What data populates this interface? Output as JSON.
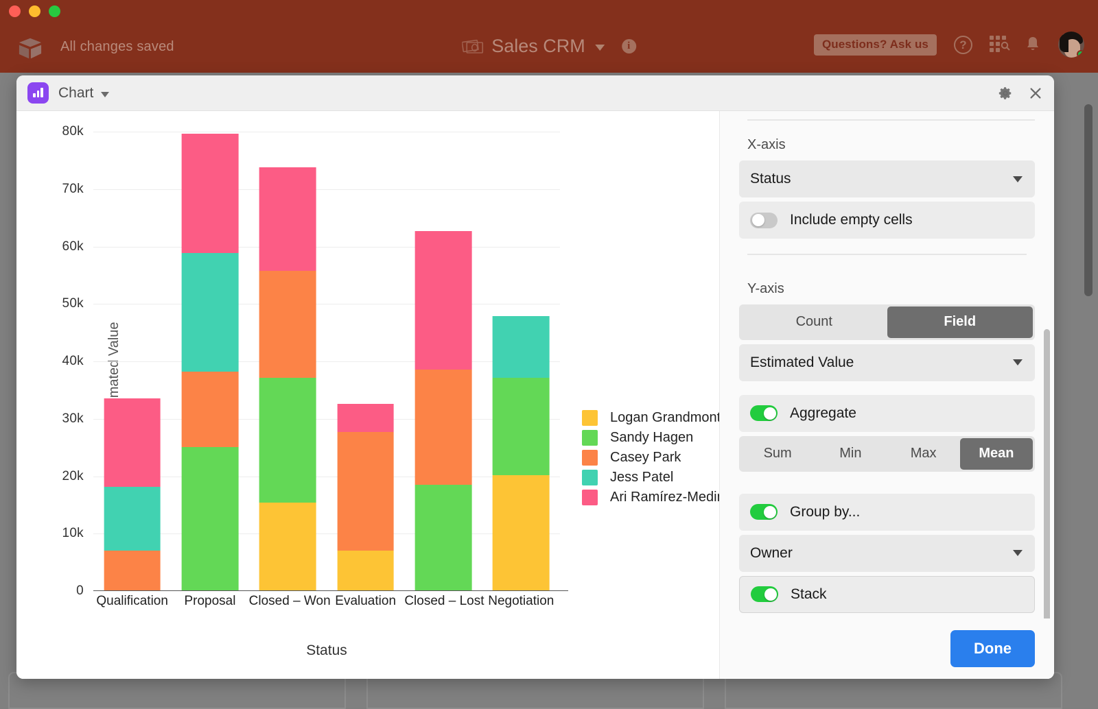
{
  "appbar": {
    "saved_status": "All changes saved",
    "base_name": "Sales CRM",
    "ask_label": "Questions? Ask us",
    "logo_icon": "airtable-cube-icon",
    "base_icon": "money-bills-icon",
    "info_icon": "info-icon",
    "help_icon": "question-mark-icon",
    "grid_icon": "apps-grid-search-icon",
    "bell_icon": "notification-bell-icon",
    "avatar_icon": "user-avatar",
    "bg_color": "#84301c"
  },
  "modal": {
    "badge_icon": "bar-chart-icon",
    "title": "Chart",
    "title_caret_icon": "chevron-down-icon",
    "gear_icon": "gear-icon",
    "close_icon": "close-icon"
  },
  "settings": {
    "xaxis": {
      "section_label": "X-axis",
      "field_value": "Status",
      "field_caret_icon": "chevron-down-icon",
      "include_empty_label": "Include empty cells",
      "include_empty_on": false
    },
    "yaxis": {
      "section_label": "Y-axis",
      "mode_options": [
        "Count",
        "Field"
      ],
      "mode_selected": "Field",
      "field_value": "Estimated Value",
      "field_caret_icon": "chevron-down-icon",
      "aggregate_label": "Aggregate",
      "aggregate_on": true,
      "agg_options": [
        "Sum",
        "Min",
        "Max",
        "Mean"
      ],
      "agg_selected": "Mean"
    },
    "group": {
      "group_by_label": "Group by...",
      "group_by_on": true,
      "group_field_value": "Owner",
      "group_caret_icon": "chevron-down-icon",
      "stack_label": "Stack",
      "stack_on": true
    },
    "done_label": "Done",
    "accent_color": "#2a7fed",
    "toggle_on_color": "#22cc3e"
  },
  "chart_data": {
    "type": "bar",
    "stacked": true,
    "title": "",
    "xlabel": "Status",
    "ylabel": "MEAN: Estimated Value",
    "ylim": [
      0,
      80000
    ],
    "yticks": [
      0,
      10000,
      20000,
      30000,
      40000,
      50000,
      60000,
      70000,
      80000
    ],
    "ytick_labels": [
      "0",
      "10k",
      "20k",
      "30k",
      "40k",
      "50k",
      "60k",
      "70k",
      "80k"
    ],
    "grid": true,
    "legend_position": "right",
    "categories": [
      "Qualification",
      "Proposal",
      "Closed – Won",
      "Evaluation",
      "Closed – Lost",
      "Negotiation"
    ],
    "series": [
      {
        "name": "Logan Grandmont",
        "color": "#fdc435",
        "values": [
          0,
          0,
          15400,
          7100,
          0,
          20200
        ]
      },
      {
        "name": "Sandy Hagen",
        "color": "#63d856",
        "values": [
          0,
          25100,
          21700,
          0,
          18500,
          16900
        ]
      },
      {
        "name": "Casey Park",
        "color": "#fc8347",
        "values": [
          7000,
          13100,
          18700,
          20600,
          20100,
          0
        ]
      },
      {
        "name": "Jess Patel",
        "color": "#41d2b1",
        "values": [
          11100,
          20700,
          0,
          0,
          0,
          10800
        ]
      },
      {
        "name": "Ari Ramírez-Medina",
        "color": "#fc5c85",
        "values": [
          15500,
          20700,
          18000,
          4900,
          24100,
          0
        ]
      }
    ],
    "stack_order": [
      "Logan Grandmont",
      "Sandy Hagen",
      "Casey Park",
      "Jess Patel",
      "Ari Ramírez-Medina"
    ],
    "totals": [
      33600,
      79600,
      73800,
      32600,
      62700,
      47900
    ]
  }
}
